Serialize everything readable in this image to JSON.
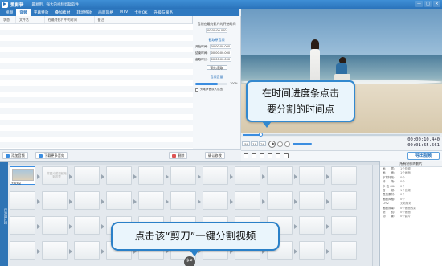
{
  "app": {
    "title": "爱剪辑",
    "subtitle": "最易用、强大的视频剪辑软件"
  },
  "window_controls": [
    "—",
    "□",
    "×"
  ],
  "tabs": [
    {
      "label": "视频"
    },
    {
      "label": "音频"
    },
    {
      "label": "字幕特效"
    },
    {
      "label": "叠加素材"
    },
    {
      "label": "转场特效"
    },
    {
      "label": "画面风格"
    },
    {
      "label": "MTV"
    },
    {
      "label": "卡拉OK"
    },
    {
      "label": "升级与服务"
    }
  ],
  "active_tab_index": 1,
  "table": {
    "columns": [
      "状态",
      "文件名",
      "在最终影片中的时间",
      "备注"
    ]
  },
  "settings": {
    "heading": "音频在最终影片的开始时间",
    "time": "00:00:00.000",
    "section1": "截取原音频",
    "start_label": "开始时间:",
    "start_value": "00:00:00.000",
    "end_label": "结束时间:",
    "end_value": "00:00:00.000",
    "dur_label": "截取时长:",
    "dur_value": "00:00:00.000",
    "preview_btn": "预览/截取",
    "section2": "音频音量",
    "volume": "100%",
    "fade_label": "头尾声音淡入淡出",
    "confirm_btn": "确认修改"
  },
  "bottom": {
    "add_audio": "添加音频",
    "download": "下载更多音效",
    "delete": "删除"
  },
  "callout_top": [
    "在时间进度条点击",
    "要分割的时间点"
  ],
  "callout_bottom": "点击该“剪刀”一键分割视频",
  "player": {
    "speed_options": [
      ".5X",
      "1X",
      "2X"
    ],
    "current": "00:00:10.440",
    "total": "00:01:55.561",
    "progress": 0.09
  },
  "export_btn": "导出视频",
  "timeline": {
    "side_label": "已添加片段",
    "clip_label": "大闹天宫",
    "clip_time": "00:01:55.561",
    "placeholder": "将图片或视频拖到这里"
  },
  "info": {
    "heading": "所有制作的影片",
    "rows": [
      {
        "k": "画　　质:",
        "v": "1个视频"
      },
      {
        "k": "画　　面:",
        "v": "1个画面"
      },
      {
        "k": "字幕特效:",
        "v": "0个"
      },
      {
        "k": "转　　场:",
        "v": "0个"
      },
      {
        "k": "卡 拉 OK:",
        "v": "0个"
      },
      {
        "k": "音　　频:",
        "v": "1个音频"
      },
      {
        "k": "叠加素材:",
        "v": "0个"
      },
      {
        "k": "画面风格:",
        "v": "0个"
      },
      {
        "k": "MTV:",
        "v": "无效特效"
      },
      {
        "k": "画面效果:",
        "v": "0个画面效果"
      },
      {
        "k": "滤　　镜:",
        "v": "0个画面"
      },
      {
        "k": "动　　景:",
        "v": "0个影片"
      }
    ]
  }
}
